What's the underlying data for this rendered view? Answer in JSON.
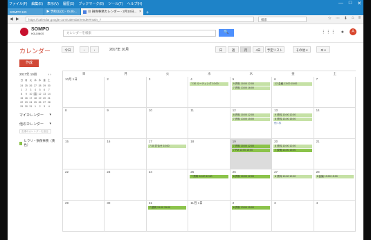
{
  "window": {
    "menus": [
      "ファイル(F)",
      "編集(E)",
      "表示(V)",
      "履歴(S)",
      "ブックマーク(B)",
      "ツール(T)",
      "ヘルプ(H)"
    ],
    "controls": [
      "—",
      "□",
      "✕"
    ],
    "tabs": [
      {
        "label": "SOMPO HD"
      },
      {
        "label": "▶ 予約(1)(2) - Outlo..."
      },
      {
        "label": "▦ 損保事務カレンダー - 2月10日..."
      }
    ],
    "newtab": "+"
  },
  "addressbar": {
    "back": "◀",
    "forward": "▶",
    "url": "https://calendar.google.com/calendar/render#main_7",
    "search_placeholder": "検索",
    "ext_icons": [
      "☆",
      "⋯",
      "⬇",
      "⌂",
      "≡"
    ]
  },
  "header": {
    "logo_name": "SOMPO",
    "logo_sub": "HOLDINGS",
    "search_placeholder": "カレンダーを検索",
    "search_button": "🔍",
    "apps_icon": "⋮⋮⋮",
    "notif_icon": "●",
    "avatar": "A"
  },
  "toolbar": {
    "app_title": "カレンダー",
    "today": "今日",
    "prev": "‹",
    "next": "›",
    "period": "2017年 10月",
    "views": [
      "日",
      "週",
      "月",
      "4日",
      "予定リスト"
    ],
    "more": "その他 ▾",
    "settings": "⚙ ▾"
  },
  "sidebar": {
    "create": "作成",
    "mini_title": "2017年 10月",
    "mini_nav": "‹ ›",
    "mini_dow": [
      "日",
      "月",
      "火",
      "水",
      "木",
      "金",
      "土"
    ],
    "mini_days": [
      "24",
      "25",
      "26",
      "27",
      "28",
      "29",
      "30",
      "1",
      "2",
      "3",
      "4",
      "5",
      "6",
      "7",
      "8",
      "9",
      "10",
      "11",
      "12",
      "13",
      "14",
      "15",
      "16",
      "17",
      "18",
      "19",
      "20",
      "21",
      "22",
      "23",
      "24",
      "25",
      "26",
      "27",
      "28",
      "29",
      "30",
      "31",
      "1",
      "2",
      "3",
      "4"
    ],
    "selected_index": 17,
    "my_calendars": "マイカレンダー",
    "other_calendars": "他のカレンダー",
    "add_placeholder": "友達のカレンダーを追加",
    "calendar_item": "ヒラリ・損保事務（黄色）"
  },
  "calendar": {
    "dow": [
      "日",
      "月",
      "火",
      "水",
      "木",
      "金",
      "土"
    ],
    "weeks": [
      [
        {
          "num": "10月 1日",
          "events": []
        },
        {
          "num": "2",
          "events": []
        },
        {
          "num": "3",
          "events": []
        },
        {
          "num": "4",
          "events": [
            {
              "text": "7:30 ミーティング 10:00",
              "dark": false
            }
          ]
        },
        {
          "num": "5",
          "events": [
            {
              "text": "9 資料 10:00 12:00",
              "dark": false
            },
            {
              "text": "7 資料 13:00 16:00",
              "dark": false
            }
          ]
        },
        {
          "num": "6",
          "events": [
            {
              "text": "12 会議 13:00 15:00",
              "dark": false
            }
          ]
        },
        {
          "num": "7",
          "events": []
        }
      ],
      [
        {
          "num": "8",
          "events": []
        },
        {
          "num": "9",
          "events": []
        },
        {
          "num": "10",
          "events": []
        },
        {
          "num": "11",
          "events": []
        },
        {
          "num": "12",
          "events": [
            {
              "text": "8 資料 10:00 12:00",
              "dark": false
            },
            {
              "text": "7 資料 13:00 15:00",
              "dark": false
            }
          ]
        },
        {
          "num": "13",
          "events": [
            {
              "text": "9 資料 10:00 12:00",
              "dark": false
            },
            {
              "text": "8 資料 13:00 15:00",
              "dark": false
            }
          ],
          "more": "他 1件"
        },
        {
          "num": "14",
          "events": []
        }
      ],
      [
        {
          "num": "15",
          "events": []
        },
        {
          "num": "16",
          "events": []
        },
        {
          "num": "17",
          "events": [
            {
              "text": "7:30 打合せ 10:00",
              "dark": false
            }
          ]
        },
        {
          "num": "18",
          "events": []
        },
        {
          "num": "19",
          "today": true,
          "events": [
            {
              "text": "7 資料 10:00 12:00",
              "dark": true
            },
            {
              "text": "7 PM 13:00 15:00",
              "dark": true
            }
          ]
        },
        {
          "num": "20",
          "events": [
            {
              "text": "8 資料 10:00 12:00",
              "dark": false
            },
            {
              "text": "7 説明 13:00 15:00",
              "dark": true
            }
          ]
        },
        {
          "num": "21",
          "events": []
        }
      ],
      [
        {
          "num": "22",
          "events": []
        },
        {
          "num": "23",
          "events": []
        },
        {
          "num": "24",
          "events": []
        },
        {
          "num": "25",
          "events": [
            {
              "text": "7 資料 10:00 12:00",
              "dark": true
            }
          ]
        },
        {
          "num": "26",
          "events": [
            {
              "text": "8 資料 10:00 12:00",
              "dark": true
            }
          ]
        },
        {
          "num": "27",
          "events": [
            {
              "text": "8 資料 10:00 12:00",
              "dark": false
            }
          ]
        },
        {
          "num": "28",
          "events": [
            {
              "text": "6 会議 13:00 15:00",
              "dark": false
            }
          ]
        }
      ],
      [
        {
          "num": "29",
          "events": []
        },
        {
          "num": "30",
          "events": []
        },
        {
          "num": "31",
          "events": [
            {
              "text": "7 説明 13:00 15:00",
              "dark": true
            }
          ]
        },
        {
          "num": "11月 1日",
          "events": []
        },
        {
          "num": "2",
          "events": [
            {
              "text": "8 資料 13:00 15:00",
              "dark": true
            }
          ]
        },
        {
          "num": "3",
          "events": []
        },
        {
          "num": "4",
          "events": []
        }
      ]
    ]
  },
  "colors": {
    "accent": "#d14836",
    "titlebar": "#1e83c8",
    "event_light": "#c5e1a5",
    "event_dark": "#8bc34a"
  }
}
